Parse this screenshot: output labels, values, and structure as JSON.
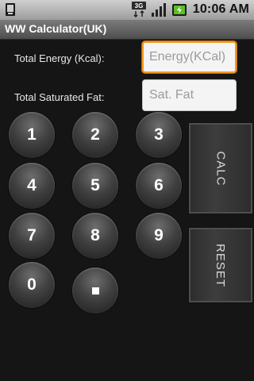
{
  "status_bar": {
    "network": "3G",
    "time": "10:06 AM",
    "icons": [
      "notification-icon",
      "3g-network-icon",
      "signal-strength-icon",
      "battery-charging-icon"
    ]
  },
  "title_bar": {
    "title": "WW Calculator(UK)"
  },
  "form": {
    "energy_label": "Total Energy (Kcal):",
    "energy_placeholder": "Energy(KCal)",
    "energy_value": "",
    "fat_label": "Total Saturated Fat:",
    "fat_placeholder": "Sat. Fat",
    "fat_value": ""
  },
  "keypad": {
    "keys": [
      "1",
      "2",
      "3",
      "4",
      "5",
      "6",
      "7",
      "8",
      "9",
      "0"
    ],
    "decimal_key_symbol": "square-dot"
  },
  "buttons": {
    "calc": "CALC",
    "reset": "RESET"
  },
  "colors": {
    "focus_border": "#f19a23",
    "background": "#151515"
  }
}
